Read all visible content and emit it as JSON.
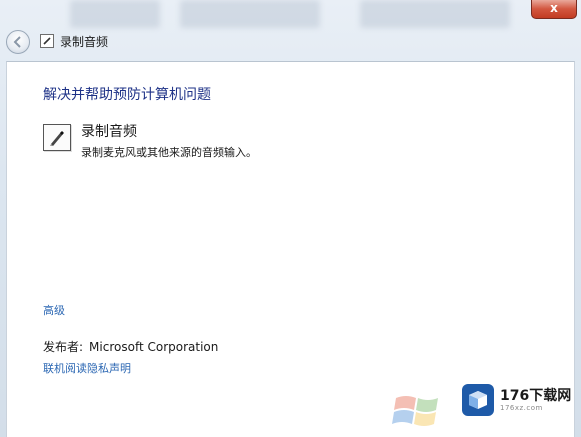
{
  "window": {
    "close_label": "x",
    "nav_title": "录制音频"
  },
  "main": {
    "heading": "解决并帮助预防计算机问题",
    "item": {
      "title": "录制音频",
      "description": "录制麦克风或其他来源的音频输入。",
      "icon": "microphone-pen-icon"
    },
    "advanced_link": "高级",
    "publisher_label": "发布者:",
    "publisher_value": "Microsoft Corporation",
    "privacy_link": "联机阅读隐私声明"
  },
  "watermark": {
    "name": "176下载网",
    "url": "176xz.com",
    "icon": "cube-logo-icon"
  },
  "colors": {
    "link": "#2b67b3",
    "heading": "#1e3287",
    "close_button": "#c23b22"
  }
}
